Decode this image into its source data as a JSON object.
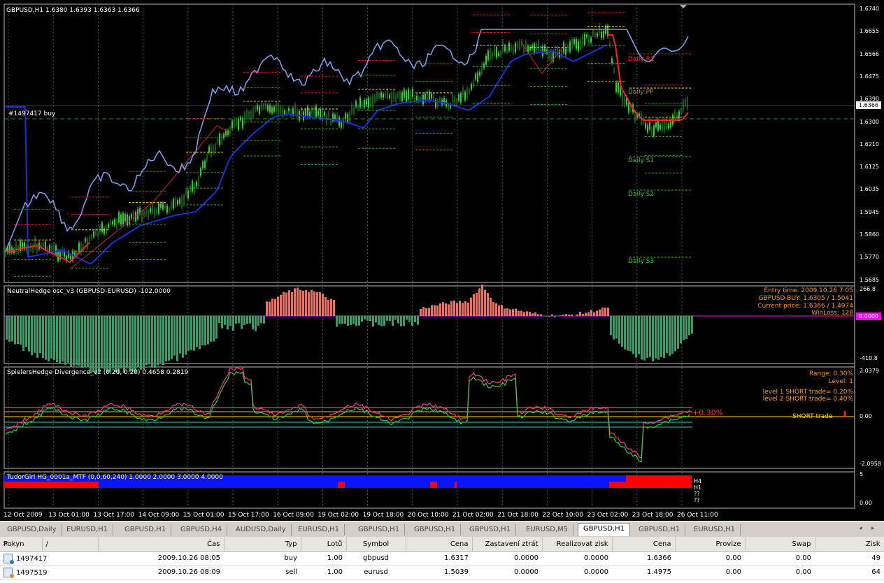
{
  "colors": {
    "background": "#000000",
    "grid": "#555555",
    "candle_up": "#33cc33",
    "ma_blue": "#1a2fe0",
    "ma_red": "#ff2222",
    "secondary": "#7f9ae8",
    "osc_pos": "#f07060",
    "osc_neg": "#3f9a6a",
    "spread_pink": "#ff3a8a",
    "spread_green": "#33cc33",
    "info_orange": "#ff9a1f",
    "level_yellow": "#ffd700"
  },
  "main": {
    "title": "GBPUSD,H1  1.6380 1.6393 1.6363 1.6366",
    "order_label": "#1497417 buy",
    "current_price": "1.6366",
    "pivots": [
      "Daily R1",
      "Daily PP",
      "Daily S1",
      "Daily S2",
      "Daily S3"
    ],
    "yticks": [
      "1.6740",
      "1.6655",
      "1.6566",
      "1.6475",
      "1.6390",
      "1.6300",
      "1.6210",
      "1.6125",
      "1.6035",
      "1.5945",
      "1.5860",
      "1.5770",
      "1.5685"
    ]
  },
  "osc": {
    "title": "NeutralHedge osc_v3 (GBPUSD-EURUSD)  -102.0000",
    "ymax": "266.8",
    "zero": "0.0000",
    "ymin": "-410.8",
    "info": [
      "Entry time:   2009.10.26 7:05",
      "GBPUSD-BUY: 1.6305 / 1.5041",
      "Current price: 1.6366 / 1.4974",
      "WinLoss: 128"
    ]
  },
  "div": {
    "title": "SpielersHedge Divergence_v2 (0.20, 0.20)  0.4658 0.2819",
    "ymax": "2.0379",
    "zero": "0.00",
    "ymin": "-2.0958",
    "info": [
      "Range: 0.30%",
      "Level: 1",
      "level 1 SHORT trade= 0.20%",
      "level 2 SHORT trade= 0.40%"
    ],
    "pct_label": "+0.30%",
    "short_label": "SHORT trade"
  },
  "tudor": {
    "title": "TudorGirl HG_0001a_MTF (0,0,60,240)  1.0000 2.0000 3.0000 4.0000",
    "ymax": "5",
    "ymin": "0.00",
    "tf_labels": [
      "H4",
      "H1",
      "??",
      "??"
    ]
  },
  "xticks": [
    "12 Oct 2009",
    "13 Oct 01:00",
    "13 Oct 17:00",
    "14 Oct 09:00",
    "15 Oct 01:00",
    "15 Oct 17:00",
    "16 Oct 09:00",
    "19 Oct 02:00",
    "19 Oct 18:00",
    "20 Oct 10:00",
    "21 Oct 02:00",
    "21 Oct 18:00",
    "22 Oct 10:00",
    "23 Oct 02:00",
    "23 Oct 18:00",
    "26 Oct 11:00"
  ],
  "tabs": [
    "GBPUSD,Daily",
    "EURUSD,H1",
    "GBPUSD,H1",
    "GBPUSD,H4",
    "AUDUSD,Daily",
    "EURUSD,H1",
    "GBPUSD,H1",
    "GBPUSD,H1",
    "GBPUSD,H1",
    "EURUSD,M5",
    "GBPUSD,H1",
    "GBPUSD,H1",
    "EURUSD,H1"
  ],
  "active_tab": 10,
  "terminal": {
    "columns": [
      "Pokyn",
      "/",
      "Čas",
      "Typ",
      "Lotů",
      "Symbol",
      "Cena",
      "Zastavení ztrát",
      "Realizovat zisk",
      "Cena",
      "Provize",
      "Swap",
      "Zisk"
    ],
    "rows": [
      [
        "1497417",
        "2009.10.26 08:05",
        "buy",
        "1.00",
        "gbpusd",
        "1.6317",
        "0.0000",
        "0.0000",
        "1.6366",
        "0.00",
        "0.00",
        "49"
      ],
      [
        "1497519",
        "2009.10.26 08:09",
        "sell",
        "1.00",
        "eurusd",
        "1.5039",
        "0.0000",
        "0.0000",
        "1.4975",
        "0.00",
        "0.00",
        "64"
      ]
    ]
  }
}
